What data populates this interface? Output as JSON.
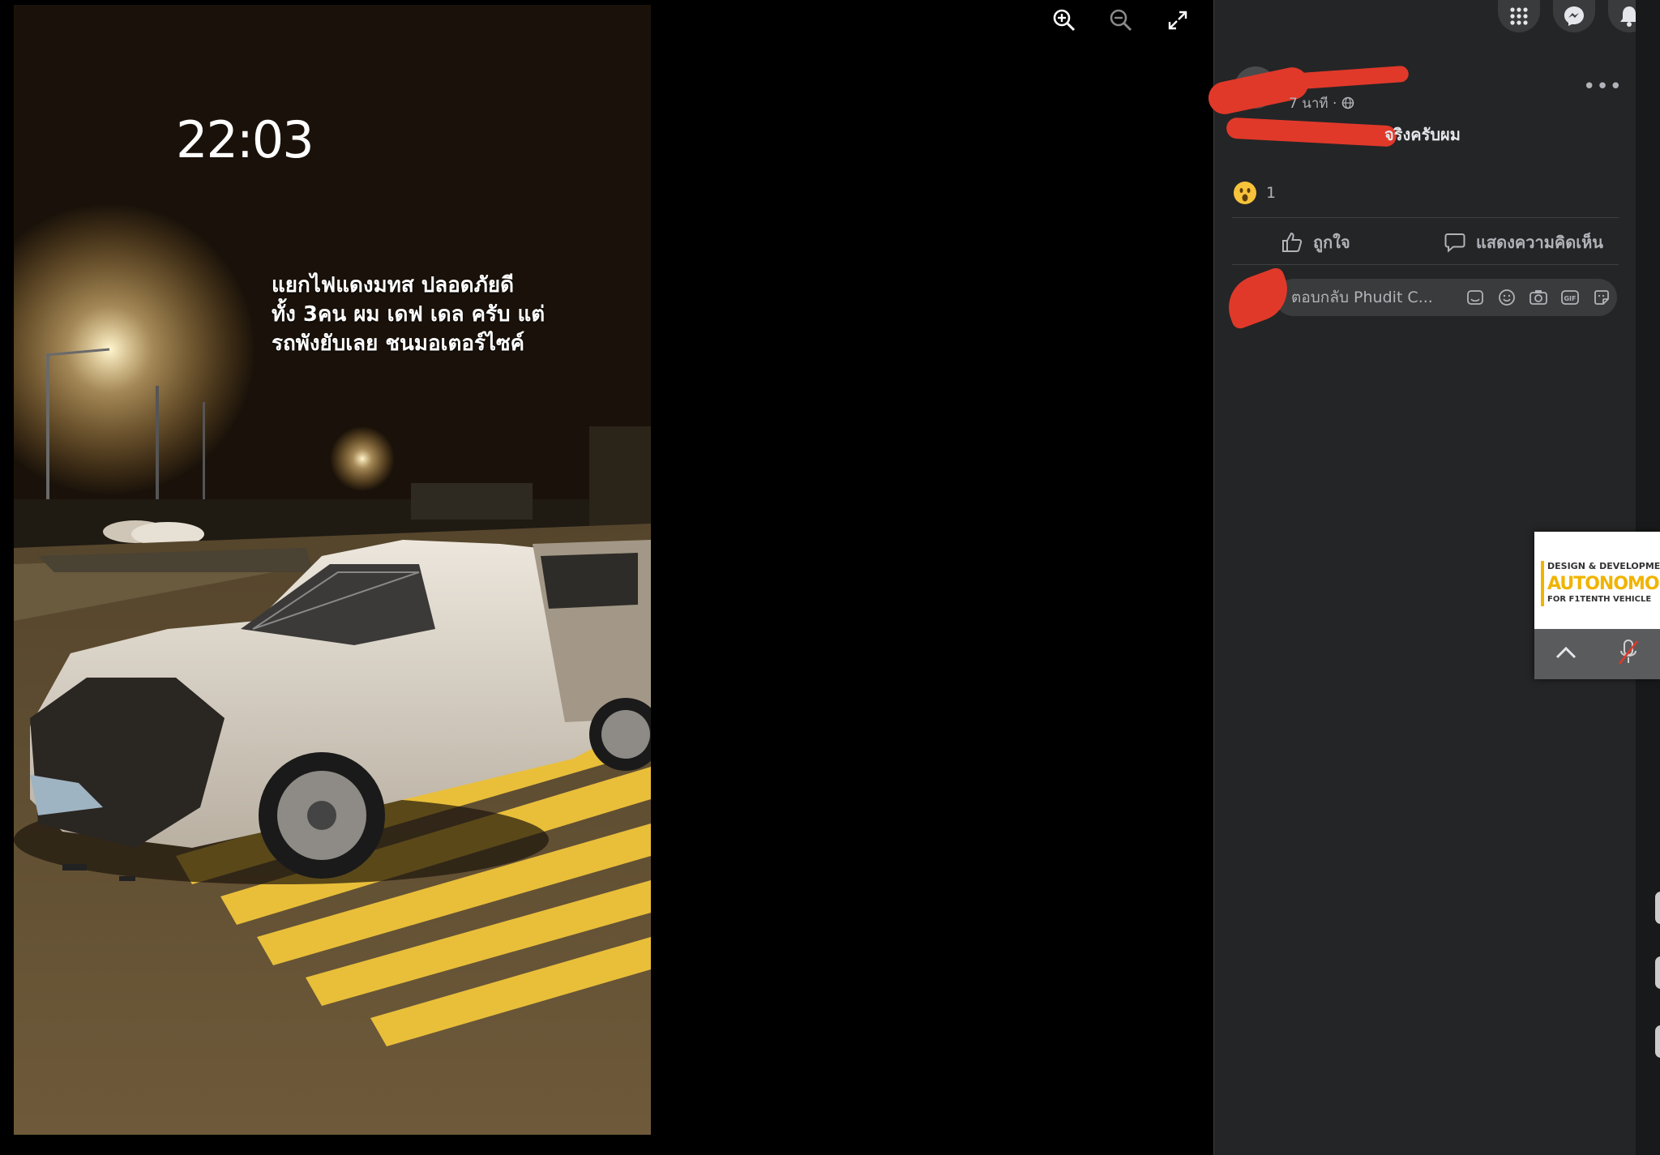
{
  "viewer": {
    "story_time": "22:03",
    "story_caption": "แยกไฟแดงมทส ปลอดภัยดี\nทั้ง 3คน ผม เดฟ เดล ครับ แต่\nรถพังยับเลย ชนมอเตอร์ไซค์",
    "controls": [
      "zoom-in-icon",
      "zoom-out-icon",
      "fullscreen-icon"
    ]
  },
  "topbar": {
    "buttons": [
      "menu-grid-icon",
      "messenger-icon",
      "bell-icon"
    ]
  },
  "post": {
    "time": "7 นาที ·",
    "text_visible": "จริงครับผม",
    "reaction_count": "1",
    "like_label": "ถูกใจ",
    "comment_label": "แสดงความคิดเห็น",
    "reply_placeholder": "ตอบกลับ Phudit C..."
  },
  "mini_player": {
    "line1": "DESIGN & DEVELOPMENT O",
    "line2": "AUTONOMOUS",
    "line3": "FOR F1TENTH VEHICLE"
  },
  "colors": {
    "panel_bg": "#242526",
    "redaction": "#e0392a",
    "accent_yellow": "#f0b400"
  }
}
